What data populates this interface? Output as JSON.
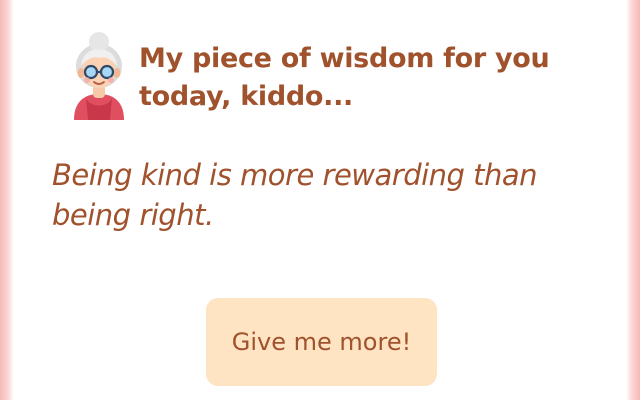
{
  "header": {
    "avatar_icon": "grandma-avatar-icon",
    "title": "My piece of wisdom for you today, kiddo..."
  },
  "quote": {
    "text": "Being kind is more rewarding than being right."
  },
  "actions": {
    "more_label": "Give me more!"
  },
  "colors": {
    "accent_text": "#a0522d",
    "button_bg": "#ffe4c4",
    "edge_tint": "#f7b9b9"
  }
}
